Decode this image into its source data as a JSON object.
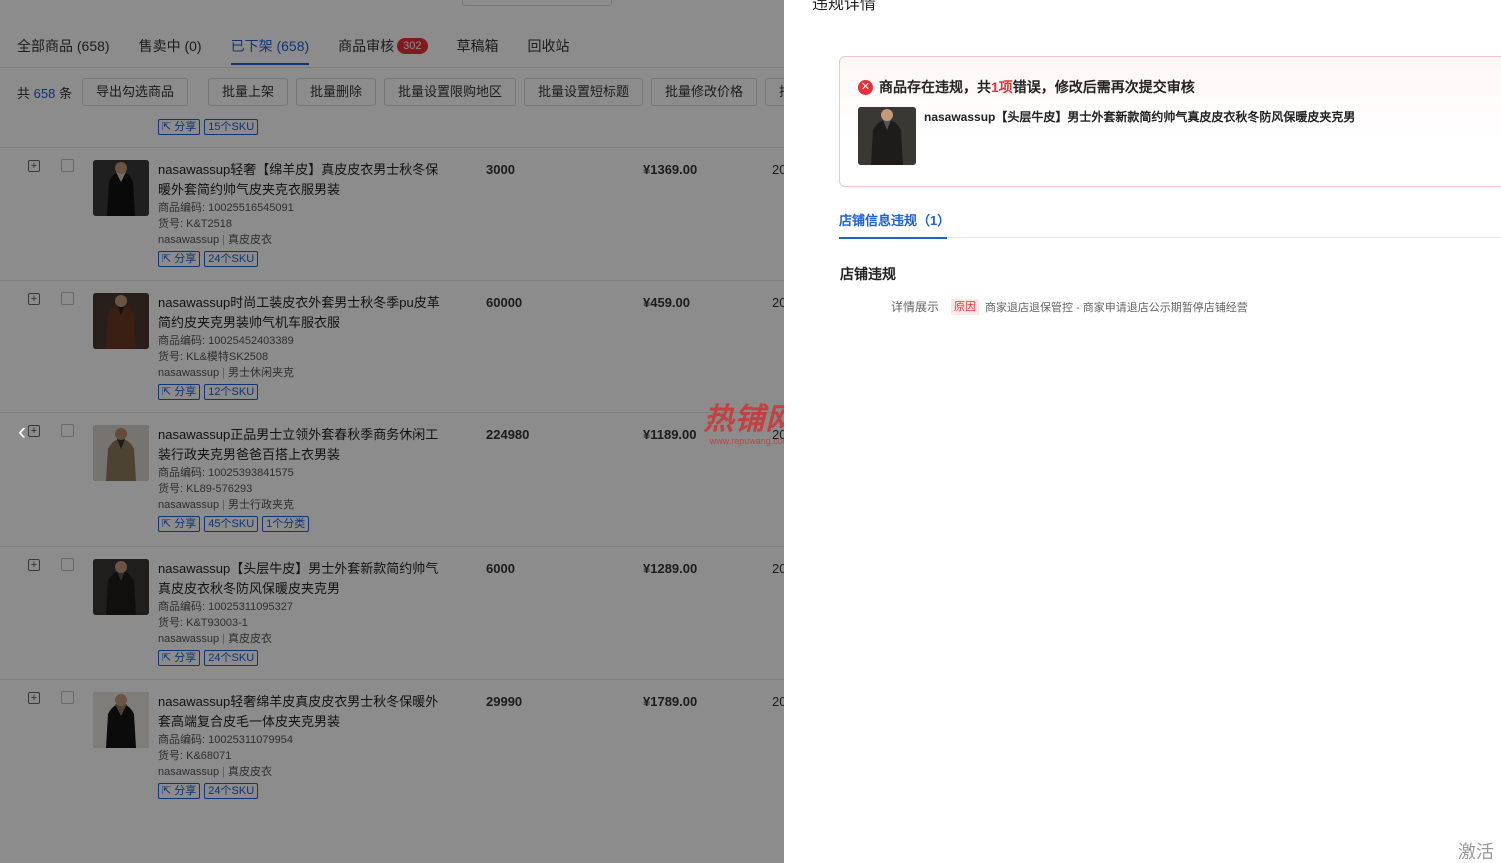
{
  "tabs": [
    {
      "label": "全部商品 (658)"
    },
    {
      "label": "售卖中 (0)"
    },
    {
      "label": "已下架 (658)"
    },
    {
      "label": "商品审核",
      "badge": "302"
    },
    {
      "label": "草稿箱"
    },
    {
      "label": "回收站"
    }
  ],
  "toolbar": {
    "total_prefix": "共 ",
    "total_count": "658",
    "total_suffix": " 条",
    "buttons": [
      "导出勾选商品",
      "批量上架",
      "批量删除",
      "批量设置限购地区",
      "批量设置短标题",
      "批量修改价格",
      "批"
    ]
  },
  "prev_row_tags": [
    "分享",
    "15个SKU"
  ],
  "products": [
    {
      "title": "nasawassup轻奢【绵羊皮】真皮皮衣男士秋冬保暖外套简约帅气皮夹克衣服男装",
      "code_label": "商品编码:",
      "code": "10025516545091",
      "sku_label": "货号:",
      "sku": "K&T2518",
      "shop": "nasawassup",
      "category": "真皮皮衣",
      "tags": [
        "分享",
        "24个SKU"
      ],
      "stock": "3000",
      "price": "¥1369.00",
      "date": "20"
    },
    {
      "title": "nasawassup时尚工装皮衣外套男士秋冬季pu皮革简约皮夹克男装帅气机车服衣服",
      "code_label": "商品编码:",
      "code": "10025452403389",
      "sku_label": "货号:",
      "sku": "KL&模特SK2508",
      "shop": "nasawassup",
      "category": "男士休闲夹克",
      "tags": [
        "分享",
        "12个SKU"
      ],
      "stock": "60000",
      "price": "¥459.00",
      "date": "20"
    },
    {
      "title": "nasawassup正品男士立领外套春秋季商务休闲工装行政夹克男爸爸百搭上衣男装",
      "code_label": "商品编码:",
      "code": "10025393841575",
      "sku_label": "货号:",
      "sku": "KL89-576293",
      "shop": "nasawassup",
      "category": "男士行政夹克",
      "tags": [
        "分享",
        "45个SKU",
        "1个分类"
      ],
      "stock": "224980",
      "price": "¥1189.00",
      "date": "20"
    },
    {
      "title": "nasawassup【头层牛皮】男士外套新款简约帅气真皮皮衣秋冬防风保暖皮夹克男",
      "code_label": "商品编码:",
      "code": "10025311095327",
      "sku_label": "货号:",
      "sku": "K&T93003-1",
      "shop": "nasawassup",
      "category": "真皮皮衣",
      "tags": [
        "分享",
        "24个SKU"
      ],
      "stock": "6000",
      "price": "¥1289.00",
      "date": "20"
    },
    {
      "title": "nasawassup轻奢绵羊皮真皮皮衣男士秋冬保暖外套高端复合皮毛一体皮夹克男装",
      "code_label": "商品编码:",
      "code": "10025311079954",
      "sku_label": "货号:",
      "sku": "K&68071",
      "shop": "nasawassup",
      "category": "真皮皮衣",
      "tags": [
        "分享",
        "24个SKU"
      ],
      "stock": "29990",
      "price": "¥1789.00",
      "date": "20"
    }
  ],
  "watermark": {
    "big": "热铺网",
    "small": "www.repuwang.com"
  },
  "drawer": {
    "title": "违规详情",
    "alert_pre": "商品存在违规，共",
    "alert_count": "1项",
    "alert_post": "错误，修改后需再次提交审核",
    "alert_product_title": "nasawassup【头层牛皮】男士外套新款简约帅气真皮皮衣秋冬防风保暖皮夹克男",
    "tab_label": "店铺信息违规（1）",
    "section_title": "店铺违规",
    "detail_label": "详情展示",
    "reason_tag": "原因",
    "detail_text": "商家退店退保管控 - 商家申请退店公示期暂停店铺经营"
  },
  "activate_text": "激活",
  "colors": {
    "accent": "#1e60d6",
    "error": "#e8303a"
  }
}
